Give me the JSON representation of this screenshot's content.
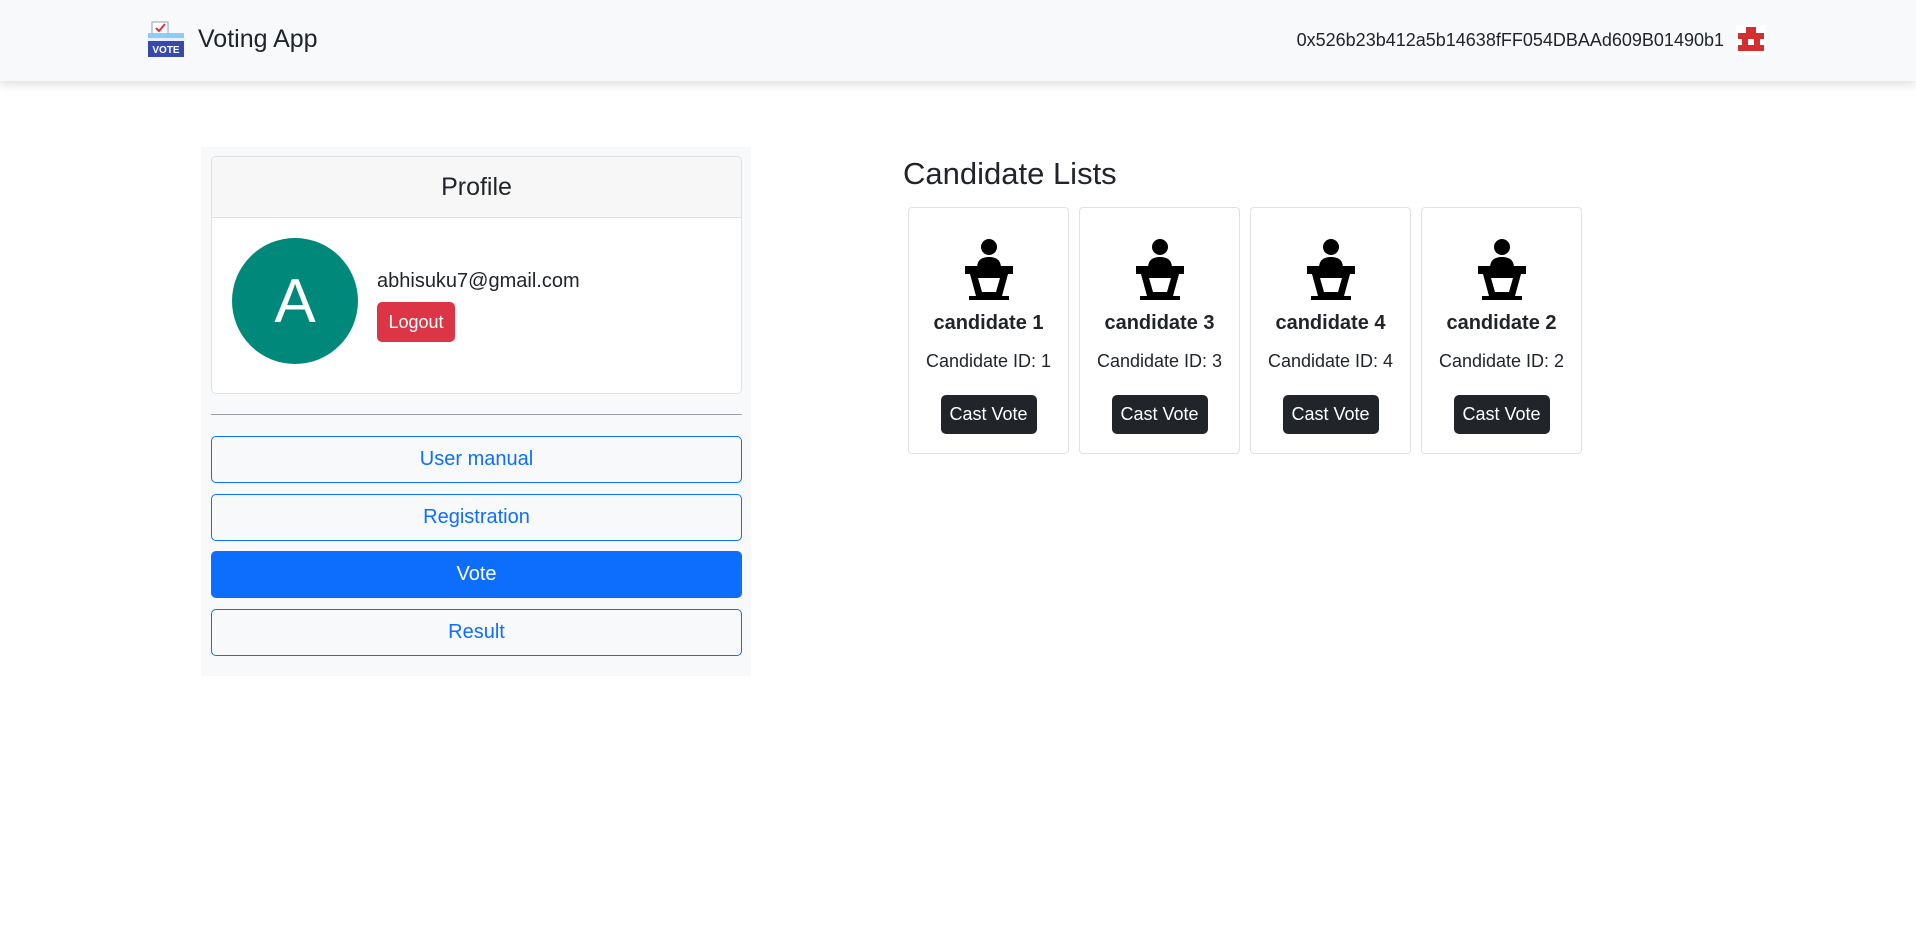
{
  "navbar": {
    "brand_name": "Voting App",
    "brand_logo_icon": "ballot-box-icon",
    "account_address": "0x526b23b412a5b14638fFF054DBAAd609B01490b1",
    "account_icon": "identicon-icon"
  },
  "profile": {
    "header": "Profile",
    "avatar_initial": "A",
    "email": "abhisuku7@gmail.com",
    "logout_label": "Logout"
  },
  "nav": {
    "user_manual": "User manual",
    "registration": "Registration",
    "vote": "Vote",
    "result": "Result",
    "active": "vote"
  },
  "candidates": {
    "title": "Candidate Lists",
    "icon": "podium-person-icon",
    "button_label": "Cast Vote",
    "items": [
      {
        "name": "candidate 1",
        "id_text": "Candidate ID: 1"
      },
      {
        "name": "candidate 3",
        "id_text": "Candidate ID: 3"
      },
      {
        "name": "candidate 4",
        "id_text": "Candidate ID: 4"
      },
      {
        "name": "candidate 2",
        "id_text": "Candidate ID: 2"
      }
    ]
  },
  "colors": {
    "primary": "#0d6efd",
    "danger": "#dc3545",
    "dark": "#212529",
    "avatar": "#00897b",
    "light": "#f8f9fa"
  }
}
